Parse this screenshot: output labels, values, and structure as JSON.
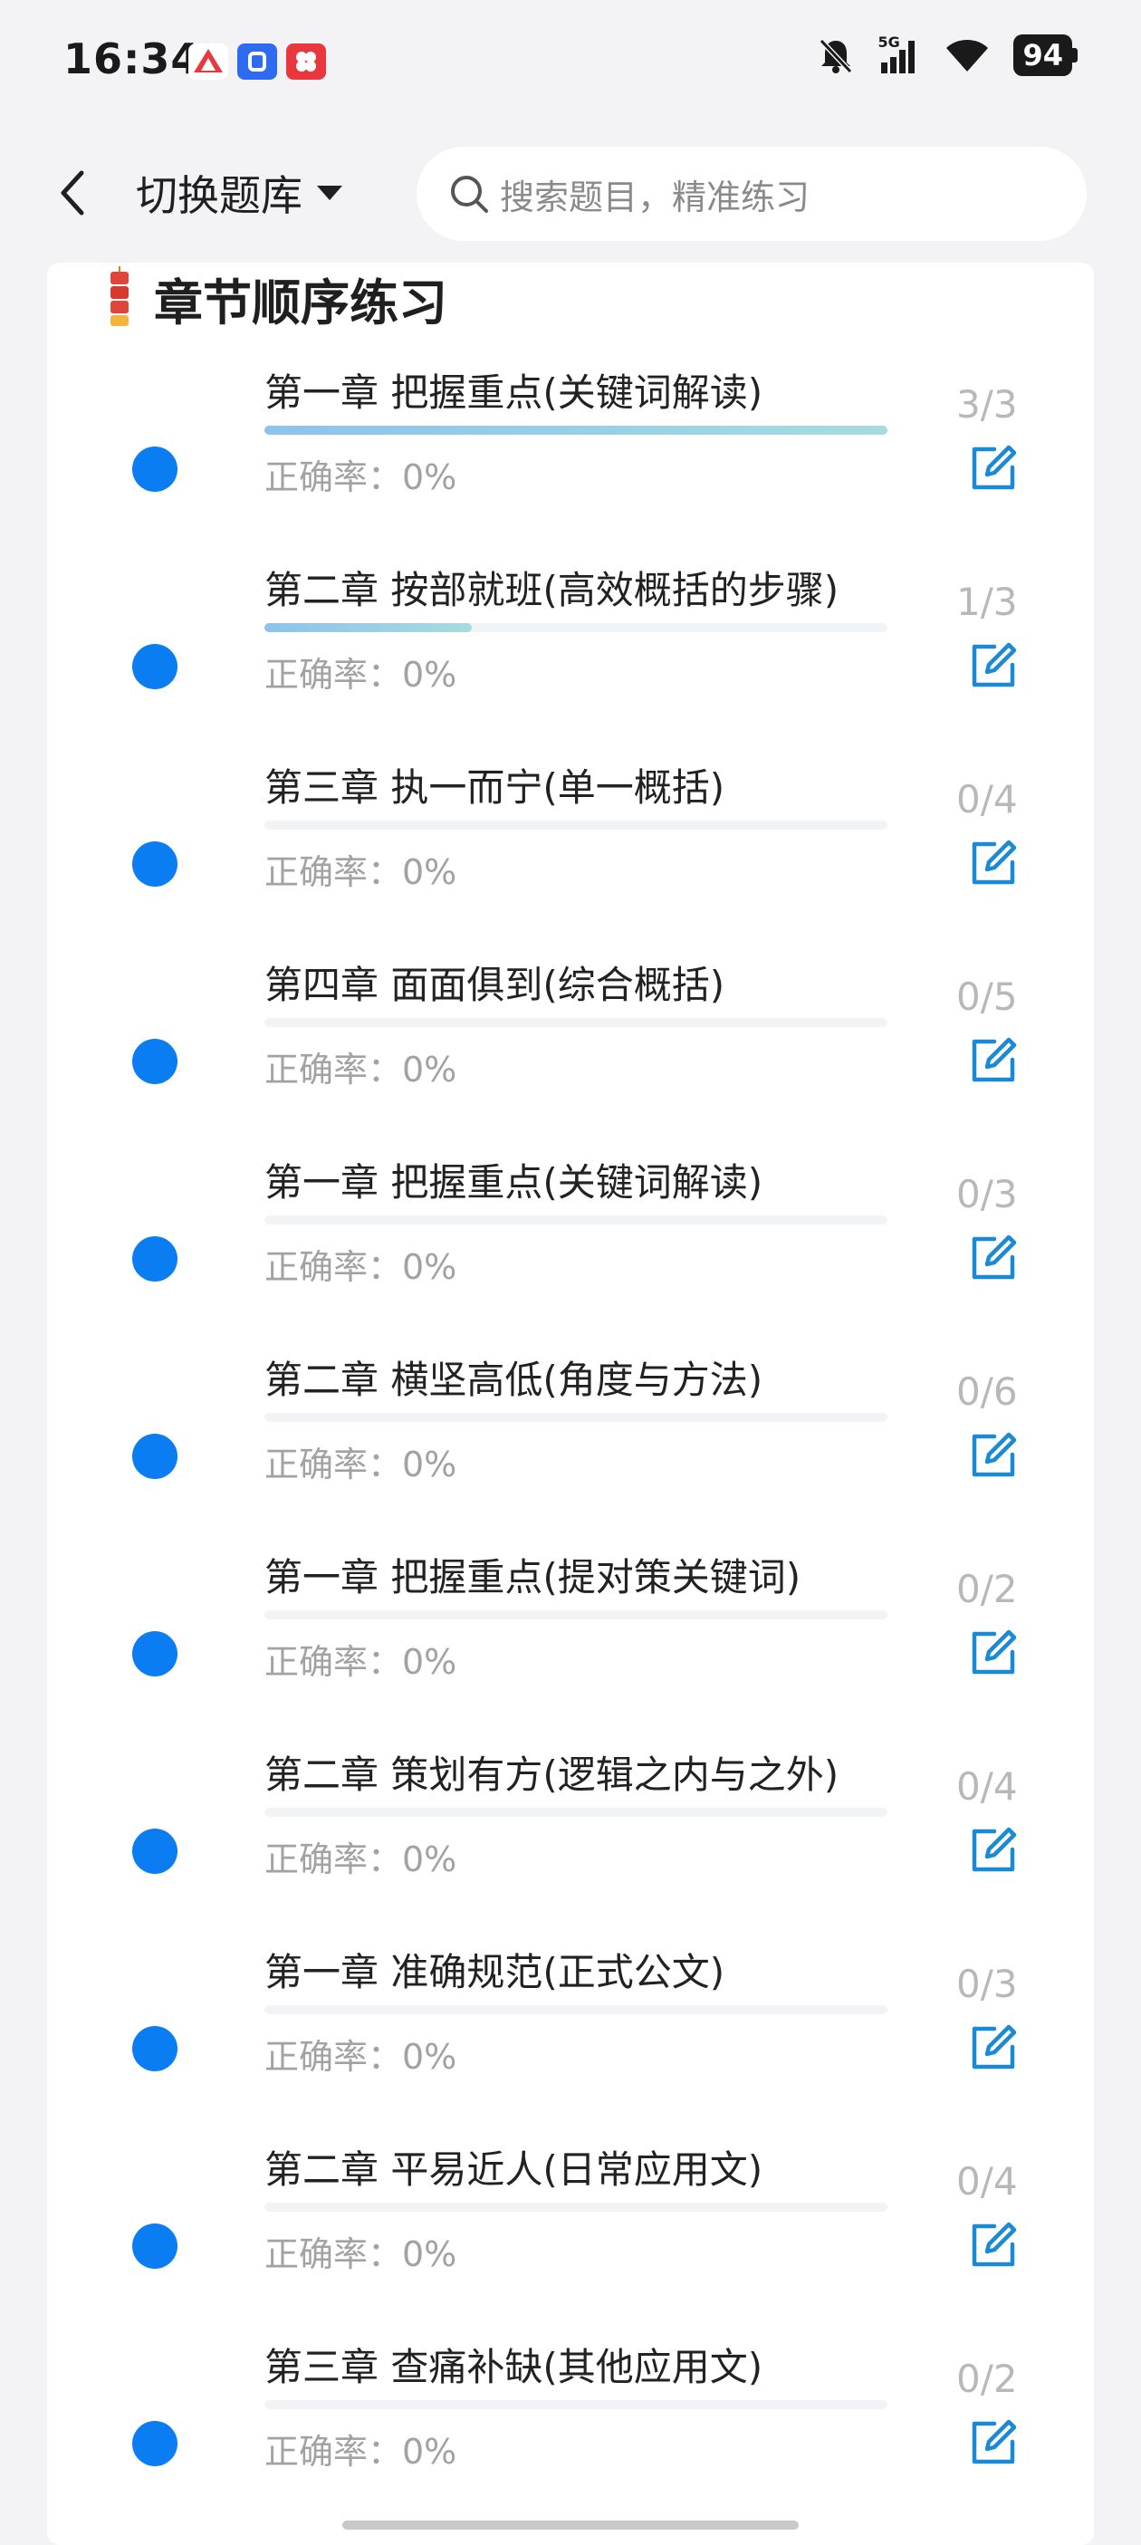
{
  "status_bar": {
    "time": "16:34",
    "network": "5G",
    "battery": "94",
    "icons": [
      "app-icon-1",
      "app-icon-2",
      "app-icon-3",
      "mute-bell-icon",
      "signal-icon",
      "wifi-icon",
      "battery-icon"
    ]
  },
  "header": {
    "back_icon": "chevron-left-icon",
    "switch_label": "切换题库",
    "search_placeholder": "搜索题目，精准练习"
  },
  "section": {
    "title": "章节顺序练习",
    "icon": "firecracker-icon"
  },
  "chapters": [
    {
      "title": "第一章 把握重点(关键词解读)",
      "accuracy": "正确率：0%",
      "count": "3/3",
      "progress": 1.0
    },
    {
      "title": "第二章 按部就班(高效概括的步骤)",
      "accuracy": "正确率：0%",
      "count": "1/3",
      "progress": 0.333
    },
    {
      "title": "第三章 执一而宁(单一概括)",
      "accuracy": "正确率：0%",
      "count": "0/4",
      "progress": 0
    },
    {
      "title": "第四章 面面俱到(综合概括)",
      "accuracy": "正确率：0%",
      "count": "0/5",
      "progress": 0
    },
    {
      "title": "第一章 把握重点(关键词解读)",
      "accuracy": "正确率：0%",
      "count": "0/3",
      "progress": 0
    },
    {
      "title": "第二章 横坚高低(角度与方法)",
      "accuracy": "正确率：0%",
      "count": "0/6",
      "progress": 0
    },
    {
      "title": "第一章 把握重点(提对策关键词)",
      "accuracy": "正确率：0%",
      "count": "0/2",
      "progress": 0
    },
    {
      "title": "第二章 策划有方(逻辑之内与之外)",
      "accuracy": "正确率：0%",
      "count": "0/4",
      "progress": 0
    },
    {
      "title": "第一章 准确规范(正式公文)",
      "accuracy": "正确率：0%",
      "count": "0/3",
      "progress": 0
    },
    {
      "title": "第二章 平易近人(日常应用文)",
      "accuracy": "正确率：0%",
      "count": "0/4",
      "progress": 0
    },
    {
      "title": "第三章 查痛补缺(其他应用文)",
      "accuracy": "正确率：0%",
      "count": "0/2",
      "progress": 0
    }
  ],
  "colors": {
    "accent": "#0a7df2",
    "progress": "#8cc3ea",
    "muted_text": "#a2a2a2",
    "edit_icon": "#1a8ad6"
  }
}
